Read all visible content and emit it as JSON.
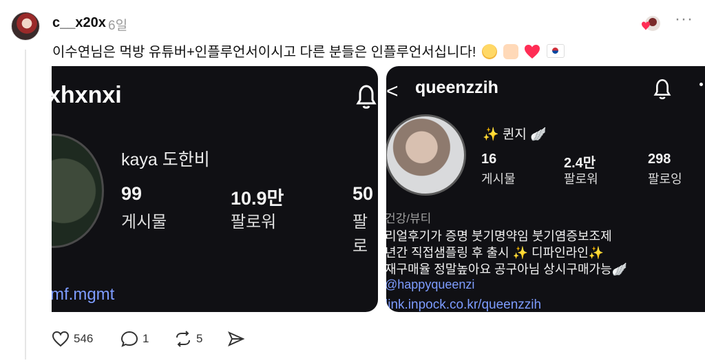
{
  "post": {
    "username": "c__x20x",
    "time": "6일",
    "text": "이수연님은 먹방 유튜버+인플루언서이시고 다른 분들은 인플루언서십니다!",
    "more": "···"
  },
  "card1": {
    "handle": "xhxnxi",
    "name": "kaya 도한비",
    "posts_count": "99",
    "posts_label": "게시물",
    "followers_count": "10.9만",
    "followers_label": "팔로워",
    "following_count": "50",
    "following_label": "팔로",
    "link": "mf.mgmt"
  },
  "card2": {
    "back": "<",
    "handle": "queenzzih",
    "name": "✨ 퀸지 🪽",
    "posts_count": "16",
    "posts_label": "게시물",
    "followers_count": "2.4만",
    "followers_label": "팔로워",
    "following_count": "298",
    "following_label": "팔로잉",
    "category": "건강/뷰티",
    "bio_lines": [
      "리얼후기가 증명 붓기명약임 붓기염증보조제",
      "년간 직접샘플링 후 출시 ✨ 디파인라인✨",
      "재구매율 정말높아요 공구아님 상시구매가능🪽"
    ],
    "mention": "@happyqueenzi",
    "link": "link.inpock.co.kr/queenzzih"
  },
  "actions": {
    "likes": "546",
    "replies": "1",
    "reposts": "5"
  },
  "colors": {
    "card_bg": "#101014",
    "link": "#7d9cff",
    "muted": "#9a9a9a"
  }
}
